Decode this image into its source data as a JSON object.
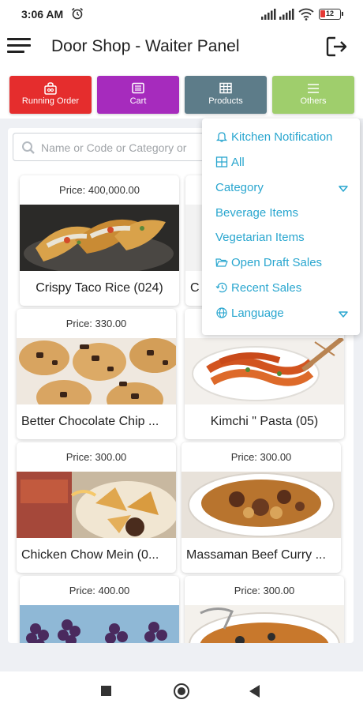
{
  "status_bar": {
    "time": "3:06 AM",
    "battery": "12"
  },
  "app": {
    "title": "Door Shop - Waiter Panel"
  },
  "tabs": [
    {
      "label": "Running Order",
      "color": "#e52d2d",
      "icon": "bag-icon"
    },
    {
      "label": "Cart",
      "color": "#a62bbd",
      "icon": "list-icon"
    },
    {
      "label": "Products",
      "color": "#5d7c89",
      "icon": "grid-icon"
    },
    {
      "label": "Others",
      "color": "#9fce6c",
      "icon": "hamburger-icon"
    }
  ],
  "search": {
    "placeholder": "Name or Code or Category or"
  },
  "products": [
    {
      "price": "Price: 400,000.00",
      "name": "Crispy Taco Rice (024)"
    },
    {
      "price": "",
      "name": "C"
    },
    {
      "price": "Price: 330.00",
      "name": "Better Chocolate Chip ..."
    },
    {
      "price": "",
      "name": "Kimchi \" Pasta (05)"
    },
    {
      "price": "Price: 300.00",
      "name": "Chicken Chow Mein (0..."
    },
    {
      "price": "Price: 300.00",
      "name": "Massaman Beef Curry ..."
    },
    {
      "price": "Price: 400.00",
      "name": ""
    },
    {
      "price": "Price: 300.00",
      "name": ""
    }
  ],
  "dropdown": {
    "items": [
      {
        "label": "Kitchen Notification",
        "icon": "bell-icon"
      },
      {
        "label": "All",
        "icon": "grid-icon"
      },
      {
        "label": "Category",
        "icon": "",
        "caret": true
      },
      {
        "label": "Beverage Items",
        "icon": ""
      },
      {
        "label": "Vegetarian Items",
        "icon": ""
      },
      {
        "label": "Open Draft Sales",
        "icon": "folder-open-icon"
      },
      {
        "label": "Recent Sales",
        "icon": "history-icon"
      },
      {
        "label": "Language",
        "icon": "globe-icon",
        "caret": true
      }
    ]
  },
  "colors": {
    "accent": "#29a6cf",
    "background": "#eef0f4"
  }
}
